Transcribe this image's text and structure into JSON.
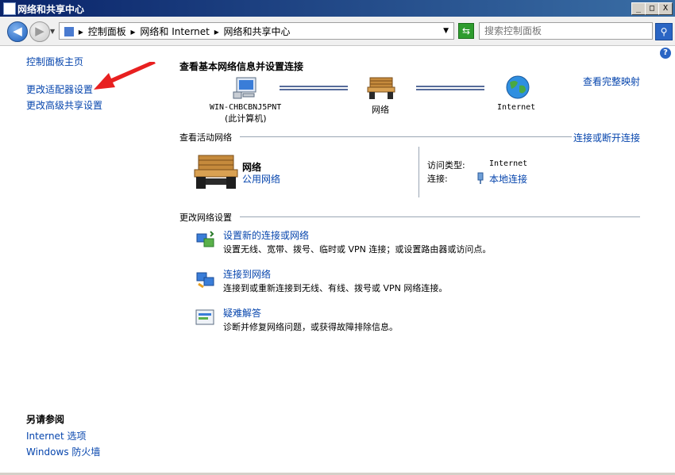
{
  "window": {
    "title": "网络和共享中心"
  },
  "caption_buttons": {
    "minimize": "_",
    "maximize": "□",
    "close": "X"
  },
  "address": {
    "crumbs": [
      "控制面板",
      "网络和 Internet",
      "网络和共享中心"
    ],
    "separator": "▸",
    "search_placeholder": "搜索控制面板"
  },
  "left": {
    "home": "控制面板主页",
    "adapter": "更改适配器设置",
    "sharing": "更改高级共享设置",
    "see_also_title": "另请参阅",
    "see_also": [
      "Internet 选项",
      "Windows 防火墙"
    ]
  },
  "main": {
    "basic_title": "查看基本网络信息并设置连接",
    "full_map": "查看完整映射",
    "nodes": {
      "computer_name": "WIN-CHBCBNJ5PNT",
      "computer_sub": "(此计算机)",
      "network": "网络",
      "internet": "Internet"
    },
    "active_title": "查看活动网络",
    "connect_disconnect": "连接或断开连接",
    "active": {
      "name": "网络",
      "type": "公用网络",
      "access_label": "访问类型:",
      "access_value": "Internet",
      "conn_label": "连接:",
      "conn_value": "本地连接"
    },
    "change_title": "更改网络设置",
    "tasks": [
      {
        "title": "设置新的连接或网络",
        "desc": "设置无线、宽带、拨号、临时或 VPN 连接；或设置路由器或访问点。"
      },
      {
        "title": "连接到网络",
        "desc": "连接到或重新连接到无线、有线、拨号或 VPN 网络连接。"
      },
      {
        "title": "疑难解答",
        "desc": "诊断并修复网络问题，或获得故障排除信息。"
      }
    ]
  },
  "colors": {
    "link": "#0645ad",
    "titlebar": "#0a246a",
    "annotation_arrow": "#e82020"
  }
}
